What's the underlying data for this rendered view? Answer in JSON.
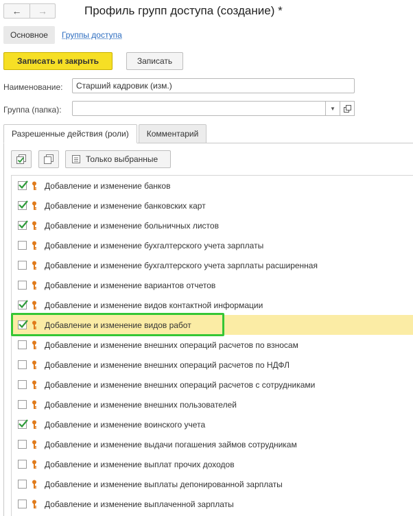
{
  "header": {
    "back_glyph": "←",
    "forward_glyph": "→",
    "title": "Профиль групп доступа (создание) *"
  },
  "top_tabs": [
    {
      "label": "Основное",
      "active": true
    },
    {
      "label": "Группы доступа",
      "active": false
    }
  ],
  "buttons": {
    "save_close": "Записать и закрыть",
    "save": "Записать"
  },
  "fields": {
    "name_label": "Наименование:",
    "name_value": "Старший кадровик (изм.)",
    "group_label": "Группа (папка):",
    "group_value": ""
  },
  "tabs": [
    {
      "label": "Разрешенные действия (роли)",
      "active": true
    },
    {
      "label": "Комментарий",
      "active": false
    }
  ],
  "toolbar": {
    "only_selected": "Только выбранные"
  },
  "colors": {
    "primary_button": "#f6df25",
    "selected_row": "#fbeca5",
    "highlight_frame": "#35c635",
    "link": "#2a6bbf",
    "checkmark": "#2e9b3a"
  },
  "roles": [
    {
      "label": "Добавление и изменение банков",
      "checked": true
    },
    {
      "label": "Добавление и изменение банковских карт",
      "checked": true
    },
    {
      "label": "Добавление и изменение больничных листов",
      "checked": true
    },
    {
      "label": "Добавление и изменение бухгалтерского учета зарплаты",
      "checked": false
    },
    {
      "label": "Добавление и изменение бухгалтерского учета зарплаты расширенная",
      "checked": false
    },
    {
      "label": "Добавление и изменение вариантов отчетов",
      "checked": false
    },
    {
      "label": "Добавление и изменение видов контактной информации",
      "checked": true
    },
    {
      "label": "Добавление и изменение видов работ",
      "checked": true,
      "selected": true,
      "highlighted": true
    },
    {
      "label": "Добавление и изменение внешних операций расчетов по взносам",
      "checked": false
    },
    {
      "label": "Добавление и изменение внешних операций расчетов по НДФЛ",
      "checked": false
    },
    {
      "label": "Добавление и изменение внешних операций расчетов с сотрудниками",
      "checked": false
    },
    {
      "label": "Добавление и изменение внешних пользователей",
      "checked": false
    },
    {
      "label": "Добавление и изменение воинского учета",
      "checked": true
    },
    {
      "label": "Добавление и изменение выдачи погашения займов сотрудникам",
      "checked": false
    },
    {
      "label": "Добавление и изменение выплат прочих доходов",
      "checked": false
    },
    {
      "label": "Добавление и изменение выплаты депонированной зарплаты",
      "checked": false
    },
    {
      "label": "Добавление и изменение выплаченной зарплаты",
      "checked": false
    }
  ]
}
